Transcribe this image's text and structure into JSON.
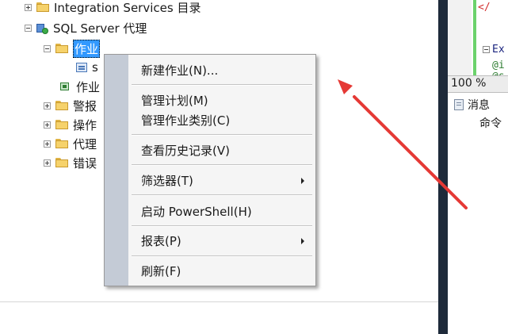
{
  "tree": {
    "integration_services": "Integration Services 目录",
    "sql_agent": "SQL Server 代理",
    "jobs": "作业",
    "job_child": "s",
    "job_activity": "作业",
    "alerts": "警报",
    "operators": "操作",
    "proxies": "代理",
    "error_logs": "错误"
  },
  "editor": {
    "line1": "</",
    "line2": "Ex",
    "line3": "@i",
    "line4": "@s",
    "zoom": "100 %"
  },
  "messages": {
    "tab_label": "消息",
    "text": "命令"
  },
  "context_menu": {
    "new_job": "新建作业(N)...",
    "manage_schedules": "管理计划(M)",
    "manage_categories": "管理作业类别(C)",
    "view_history": "查看历史记录(V)",
    "filter": "筛选器(T)",
    "powershell": "启动 PowerShell(H)",
    "reports": "报表(P)",
    "refresh": "刷新(F)"
  },
  "colors": {
    "selection": "#3399ff",
    "annotation_arrow": "#e53935",
    "menu_strip": "#c4cbd6"
  }
}
